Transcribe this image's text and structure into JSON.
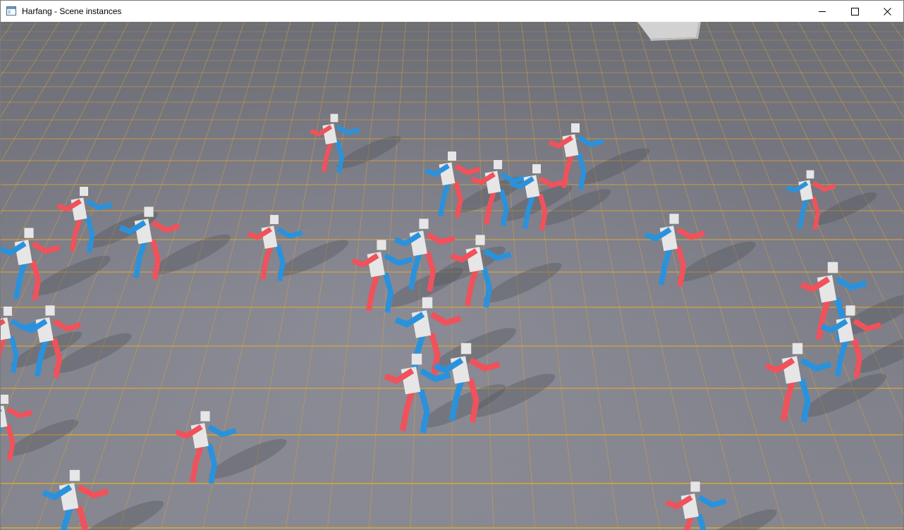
{
  "window": {
    "title": "Harfang - Scene instances",
    "app_icon": "app-window-icon",
    "controls": {
      "minimize_icon": "minimize-icon",
      "maximize_icon": "maximize-icon",
      "close_icon": "close-icon"
    }
  },
  "scene": {
    "floor_color": "#707079",
    "grid_color": "#d8a43a",
    "team_colors": {
      "red": "#f0525b",
      "blue": "#2a92dc",
      "body": "#e6e6e6"
    }
  }
}
